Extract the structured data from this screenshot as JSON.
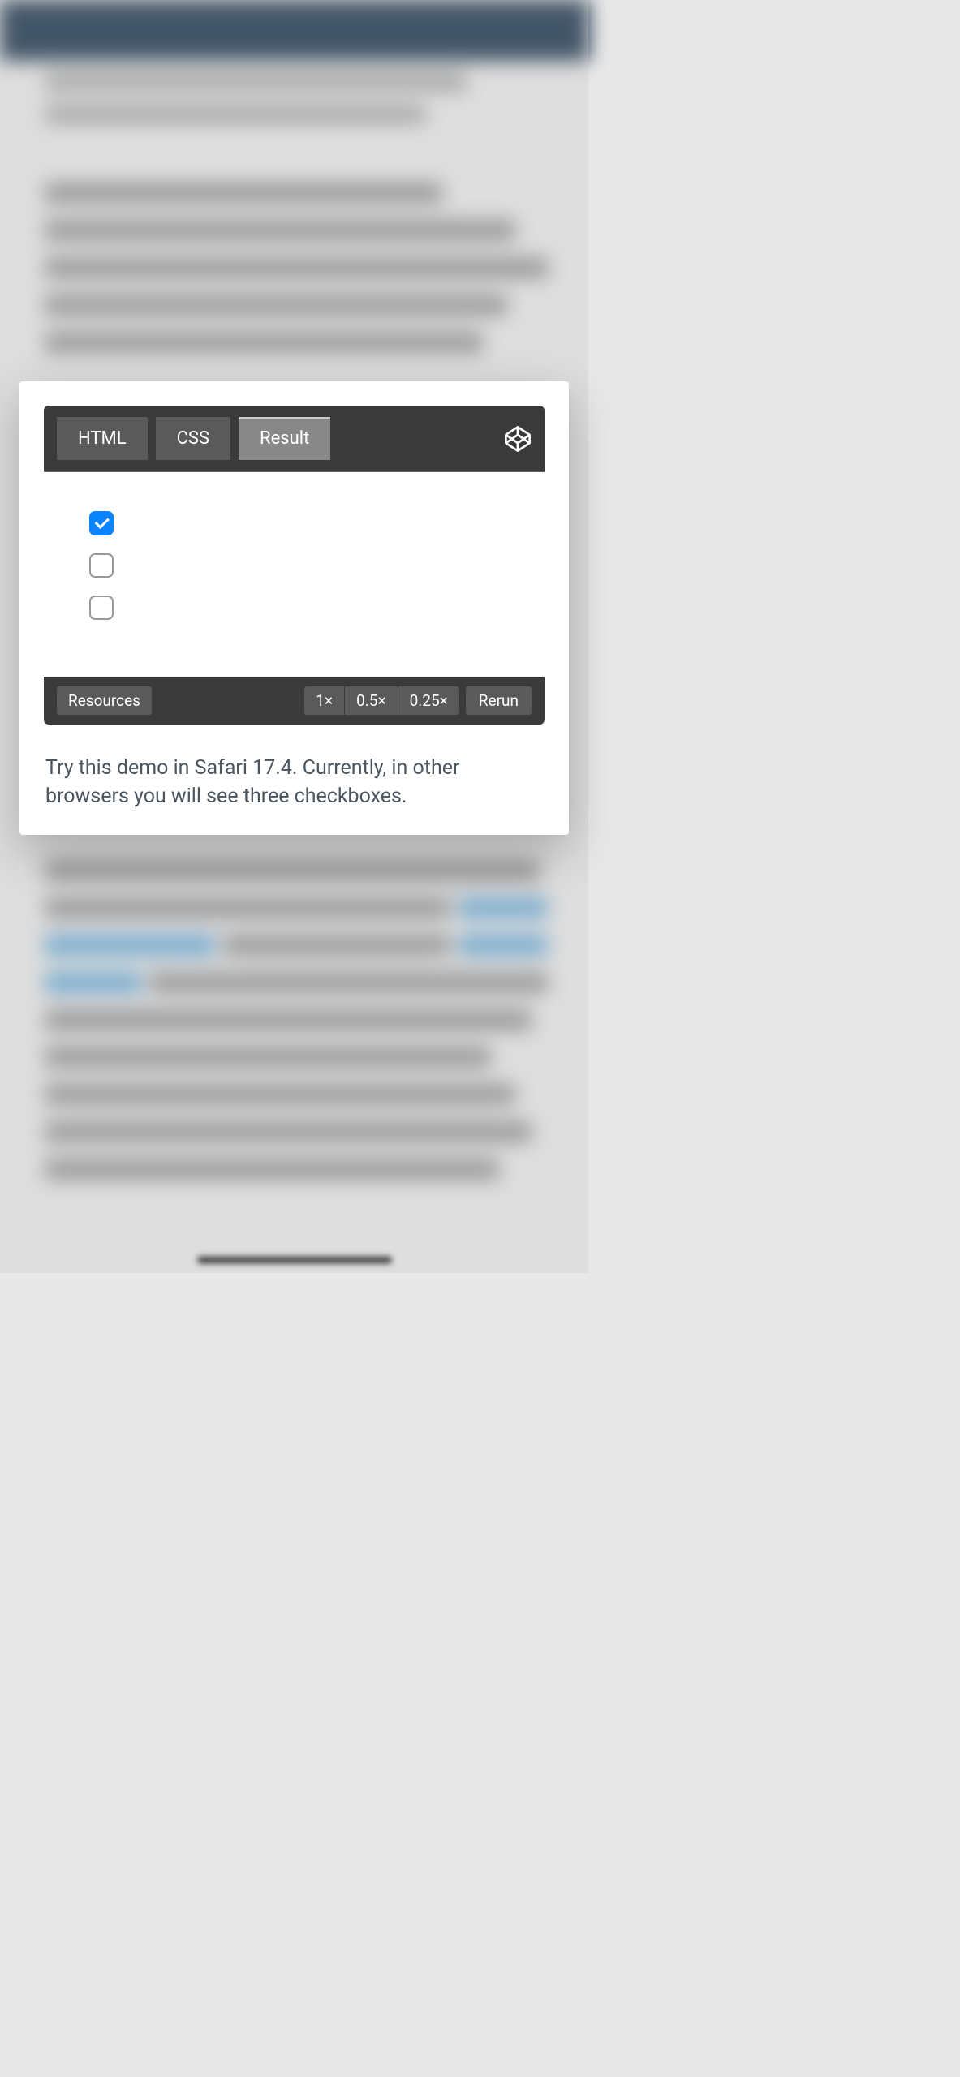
{
  "codepen": {
    "tabs": {
      "html": "HTML",
      "css": "CSS",
      "result": "Result"
    },
    "checkboxes": [
      {
        "checked": true
      },
      {
        "checked": false
      },
      {
        "checked": false
      }
    ],
    "bottom": {
      "resources": "Resources",
      "zoom1": "1×",
      "zoom05": "0.5×",
      "zoom025": "0.25×",
      "rerun": "Rerun"
    }
  },
  "caption": "Try this demo in Safari 17.4. Currently, in other browsers you will see three checkboxes."
}
